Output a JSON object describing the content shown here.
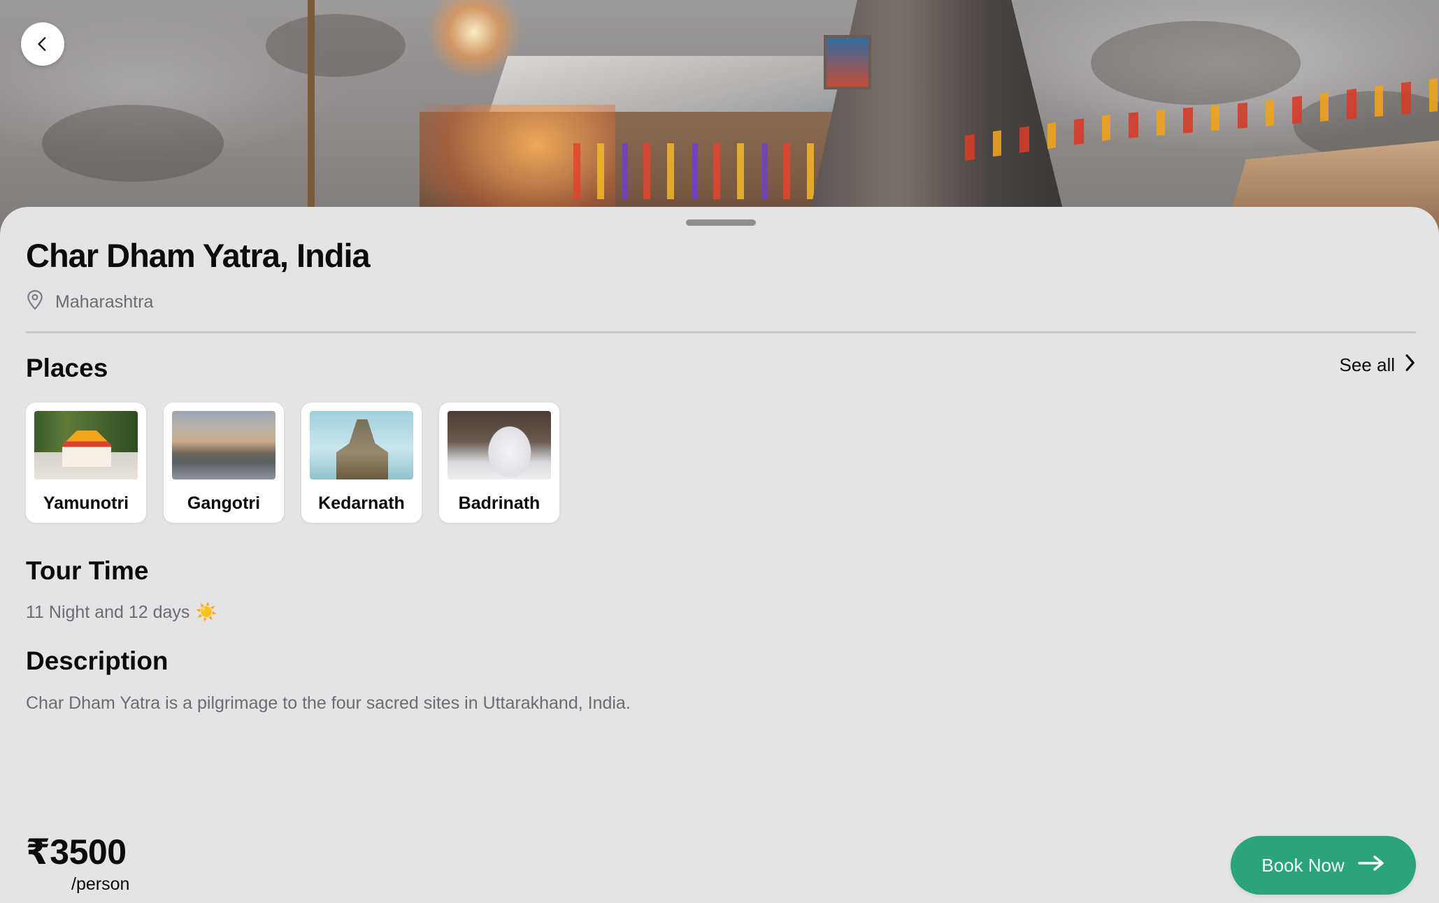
{
  "colors": {
    "background": "#e4e4e7",
    "accent": "#2aa57b",
    "text_primary": "#0b0b0c",
    "text_secondary": "#6c6c72"
  },
  "header": {
    "back_icon": "chevron-left-icon"
  },
  "trip": {
    "title": "Char Dham Yatra, India",
    "location": "Maharashtra",
    "location_icon": "map-pin-icon"
  },
  "places": {
    "heading": "Places",
    "see_all_label": "See all",
    "see_all_icon": "chevron-right-icon",
    "items": [
      {
        "name": "Yamunotri"
      },
      {
        "name": "Gangotri"
      },
      {
        "name": "Kedarnath"
      },
      {
        "name": "Badrinath"
      }
    ]
  },
  "tour_time": {
    "heading": "Tour Time",
    "value": "11 Night and 12 days",
    "emoji": "☀️"
  },
  "description": {
    "heading": "Description",
    "text": "Char Dham Yatra is a pilgrimage to the four sacred sites in Uttarakhand, India."
  },
  "booking": {
    "price": "₹3500",
    "per_unit": "/person",
    "button_label": "Book Now",
    "button_icon": "arrow-right-icon"
  }
}
